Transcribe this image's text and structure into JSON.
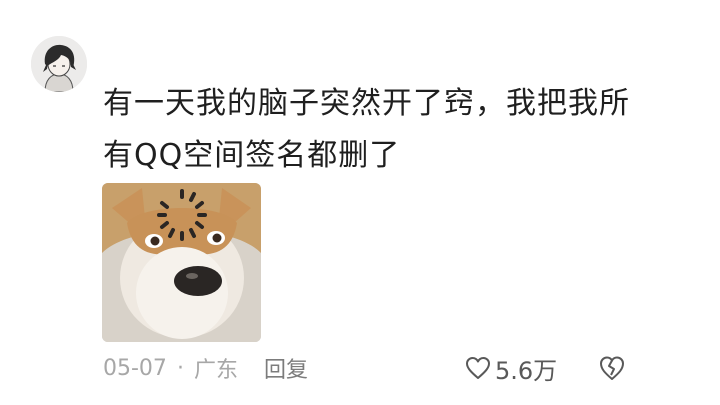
{
  "comment": {
    "line1": "有一天我的脑子突然开了窍，我把我所",
    "line2": "有QQ空间签名都删了"
  },
  "meta": {
    "date": "05-07",
    "separator": "·",
    "location": "广东",
    "reply_label": "回复"
  },
  "actions": {
    "like_count": "5.6万"
  },
  "icons": {
    "like": "heart-outline-icon",
    "dislike": "broken-heart-icon"
  },
  "colors": {
    "text": "#1f1f1f",
    "meta": "#a7a7a7",
    "reply": "#7c7c7c",
    "icon": "#595959"
  }
}
